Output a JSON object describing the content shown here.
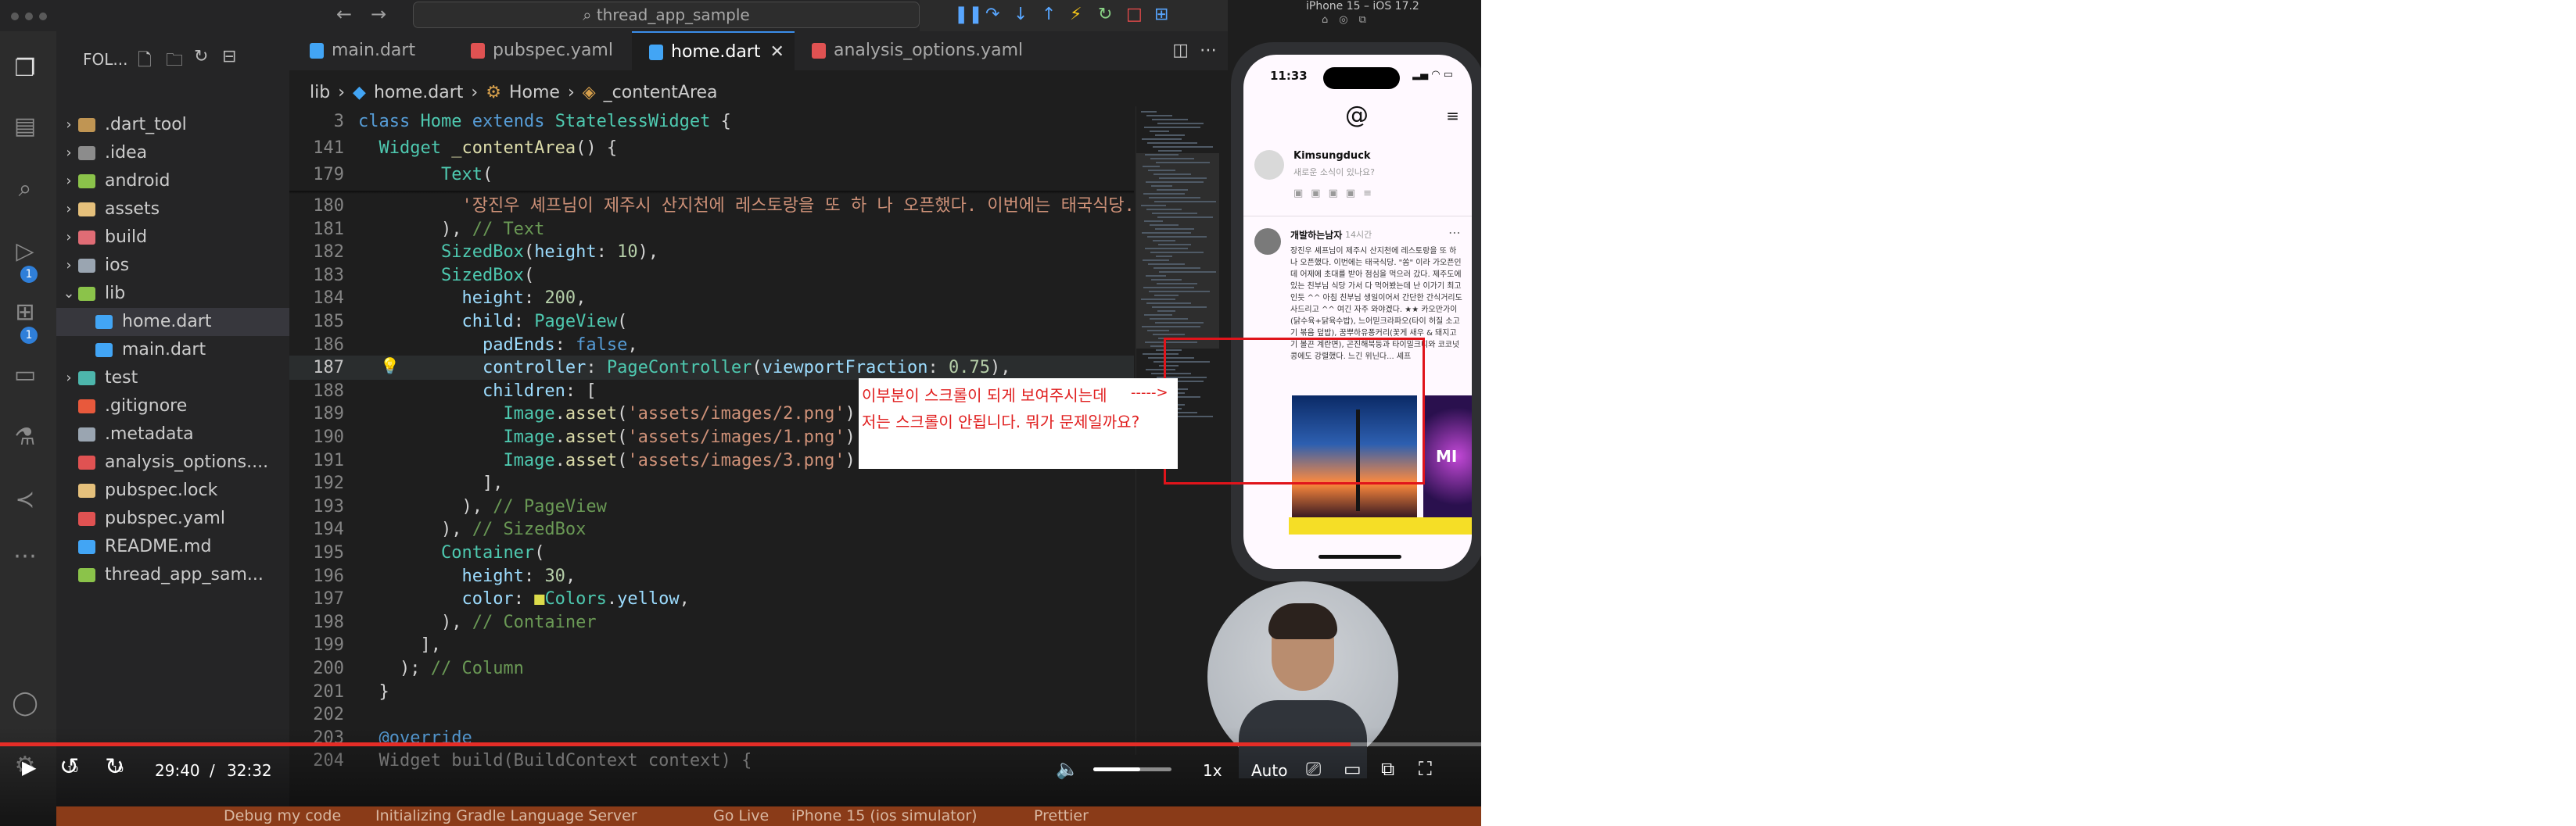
{
  "titlebar": {
    "search": "thread_app_sample",
    "nav_back_icon": "arrow-left-icon",
    "nav_forward_icon": "arrow-right-icon"
  },
  "sidebar": {
    "title": "FOL...",
    "tree": [
      {
        "label": ".dart_tool",
        "type": "folder",
        "expanded": false,
        "icon_color": "#c09553"
      },
      {
        "label": ".idea",
        "type": "folder",
        "expanded": false,
        "icon_color": "#8c8c8c"
      },
      {
        "label": "android",
        "type": "folder",
        "expanded": false,
        "icon_color": "#8bc34a"
      },
      {
        "label": "assets",
        "type": "folder",
        "expanded": false,
        "icon_color": "#e5c07b"
      },
      {
        "label": "build",
        "type": "folder",
        "expanded": false,
        "icon_color": "#e06c75"
      },
      {
        "label": "ios",
        "type": "folder",
        "expanded": false,
        "icon_color": "#9aa5b1"
      },
      {
        "label": "lib",
        "type": "folder",
        "expanded": true,
        "icon_color": "#8bc34a"
      },
      {
        "label": "home.dart",
        "type": "file",
        "indent": 1,
        "selected": true,
        "icon_color": "#42a5f5"
      },
      {
        "label": "main.dart",
        "type": "file",
        "indent": 1,
        "icon_color": "#42a5f5"
      },
      {
        "label": "test",
        "type": "folder",
        "expanded": false,
        "icon_color": "#4db6ac"
      },
      {
        "label": ".gitignore",
        "type": "file",
        "icon_color": "#e8593c"
      },
      {
        "label": ".metadata",
        "type": "file",
        "icon_color": "#9aa5b1"
      },
      {
        "label": "analysis_options....",
        "type": "file",
        "icon_color": "#e05252"
      },
      {
        "label": "pubspec.lock",
        "type": "file",
        "icon_color": "#e5c07b"
      },
      {
        "label": "pubspec.yaml",
        "type": "file",
        "icon_color": "#e05252"
      },
      {
        "label": "README.md",
        "type": "file",
        "icon_color": "#42a5f5"
      },
      {
        "label": "thread_app_sam...",
        "type": "file",
        "icon_color": "#8bc34a"
      }
    ]
  },
  "tabs": [
    {
      "label": "main.dart",
      "icon_color": "#42a5f5"
    },
    {
      "label": "pubspec.yaml",
      "icon_color": "#e05252"
    },
    {
      "label": "home.dart",
      "icon_color": "#42a5f5",
      "active": true
    },
    {
      "label": "analysis_options.yaml",
      "icon_color": "#e05252"
    }
  ],
  "breadcrumb": [
    "lib",
    "home.dart",
    "Home",
    "_contentArea"
  ],
  "sticky_lines": [
    {
      "num": "3",
      "tokens": [
        [
          "k",
          "class "
        ],
        [
          "t",
          "Home "
        ],
        [
          "k",
          "extends "
        ],
        [
          "t",
          "StatelessWidget "
        ],
        [
          "d",
          "{"
        ]
      ]
    },
    {
      "num": "141",
      "tokens": [
        [
          "d",
          "  "
        ],
        [
          "t",
          "Widget "
        ],
        [
          "f",
          "_contentArea"
        ],
        [
          "d",
          "() {"
        ]
      ]
    },
    {
      "num": "179",
      "tokens": [
        [
          "d",
          "        "
        ],
        [
          "t",
          "Text"
        ],
        [
          "d",
          "("
        ]
      ]
    }
  ],
  "code_lines": [
    {
      "num": "180",
      "tokens": [
        [
          "d",
          "          "
        ],
        [
          "s",
          "'장진우 셰프님이 제주시 산지천에 레스토랑을 또 하 나 오픈했다. 이번에는 태국식당. \"쏨\" 이"
        ]
      ]
    },
    {
      "num": "181",
      "tokens": [
        [
          "d",
          "        ), "
        ],
        [
          "c",
          "// Text"
        ]
      ]
    },
    {
      "num": "182",
      "tokens": [
        [
          "d",
          "        "
        ],
        [
          "t",
          "SizedBox"
        ],
        [
          "d",
          "("
        ],
        [
          "p",
          "height"
        ],
        [
          "d",
          ": "
        ],
        [
          "n",
          "10"
        ],
        [
          "d",
          "),"
        ]
      ]
    },
    {
      "num": "183",
      "tokens": [
        [
          "d",
          "        "
        ],
        [
          "t",
          "SizedBox"
        ],
        [
          "d",
          "("
        ]
      ]
    },
    {
      "num": "184",
      "tokens": [
        [
          "d",
          "          "
        ],
        [
          "p",
          "height"
        ],
        [
          "d",
          ": "
        ],
        [
          "n",
          "200"
        ],
        [
          "d",
          ","
        ]
      ]
    },
    {
      "num": "185",
      "tokens": [
        [
          "d",
          "          "
        ],
        [
          "p",
          "child"
        ],
        [
          "d",
          ": "
        ],
        [
          "t",
          "PageView"
        ],
        [
          "d",
          "("
        ]
      ]
    },
    {
      "num": "186",
      "tokens": [
        [
          "d",
          "            "
        ],
        [
          "p",
          "padEnds"
        ],
        [
          "d",
          ": "
        ],
        [
          "k",
          "false"
        ],
        [
          "d",
          ","
        ]
      ]
    },
    {
      "num": "187",
      "current": true,
      "tokens": [
        [
          "d",
          "            "
        ],
        [
          "p",
          "controller"
        ],
        [
          "d",
          ": "
        ],
        [
          "t",
          "PageController"
        ],
        [
          "d",
          "("
        ],
        [
          "p",
          "viewportFraction"
        ],
        [
          "d",
          ": "
        ],
        [
          "n",
          "0.75"
        ],
        [
          "d",
          "),"
        ]
      ]
    },
    {
      "num": "188",
      "tokens": [
        [
          "d",
          "            "
        ],
        [
          "p",
          "children"
        ],
        [
          "d",
          ": ["
        ]
      ]
    },
    {
      "num": "189",
      "tokens": [
        [
          "d",
          "              "
        ],
        [
          "t",
          "Image"
        ],
        [
          "d",
          "."
        ],
        [
          "f",
          "asset"
        ],
        [
          "d",
          "("
        ],
        [
          "s",
          "'assets/images/2.png'"
        ],
        [
          "d",
          "),"
        ]
      ]
    },
    {
      "num": "190",
      "tokens": [
        [
          "d",
          "              "
        ],
        [
          "t",
          "Image"
        ],
        [
          "d",
          "."
        ],
        [
          "f",
          "asset"
        ],
        [
          "d",
          "("
        ],
        [
          "s",
          "'assets/images/1.png'"
        ],
        [
          "d",
          "),"
        ]
      ]
    },
    {
      "num": "191",
      "tokens": [
        [
          "d",
          "              "
        ],
        [
          "t",
          "Image"
        ],
        [
          "d",
          "."
        ],
        [
          "f",
          "asset"
        ],
        [
          "d",
          "("
        ],
        [
          "s",
          "'assets/images/3.png'"
        ],
        [
          "d",
          "),"
        ]
      ]
    },
    {
      "num": "192",
      "tokens": [
        [
          "d",
          "            ],"
        ]
      ]
    },
    {
      "num": "193",
      "tokens": [
        [
          "d",
          "          ), "
        ],
        [
          "c",
          "// PageView"
        ]
      ]
    },
    {
      "num": "194",
      "tokens": [
        [
          "d",
          "        ), "
        ],
        [
          "c",
          "// SizedBox"
        ]
      ]
    },
    {
      "num": "195",
      "tokens": [
        [
          "d",
          "        "
        ],
        [
          "t",
          "Container"
        ],
        [
          "d",
          "("
        ]
      ]
    },
    {
      "num": "196",
      "tokens": [
        [
          "d",
          "          "
        ],
        [
          "p",
          "height"
        ],
        [
          "d",
          ": "
        ],
        [
          "n",
          "30"
        ],
        [
          "d",
          ","
        ]
      ]
    },
    {
      "num": "197",
      "tokens": [
        [
          "d",
          "          "
        ],
        [
          "p",
          "color"
        ],
        [
          "d",
          ": "
        ],
        [
          "y",
          "■"
        ],
        [
          "t",
          "Colors"
        ],
        [
          "d",
          "."
        ],
        [
          "p",
          "yellow"
        ],
        [
          "d",
          ","
        ]
      ]
    },
    {
      "num": "198",
      "tokens": [
        [
          "d",
          "        ), "
        ],
        [
          "c",
          "// Container"
        ]
      ]
    },
    {
      "num": "199",
      "tokens": [
        [
          "d",
          "      ],"
        ]
      ]
    },
    {
      "num": "200",
      "tokens": [
        [
          "d",
          "    ); "
        ],
        [
          "c",
          "// Column"
        ]
      ]
    },
    {
      "num": "201",
      "tokens": [
        [
          "d",
          "  }"
        ]
      ]
    },
    {
      "num": "202",
      "tokens": [
        [
          "d",
          ""
        ]
      ]
    },
    {
      "num": "203",
      "tokens": [
        [
          "d",
          "  "
        ],
        [
          "k",
          "@override"
        ]
      ]
    },
    {
      "num": "204",
      "tokens": [
        [
          "d",
          "  "
        ],
        [
          "gy",
          "Widget build(BuildContext context) {"
        ]
      ]
    }
  ],
  "simulator": {
    "title": "iPhone 15 – iOS 17.2",
    "clock": "11:33",
    "compose_user": "Kimsungduck",
    "compose_hint": "새로운 소식이 있나요?",
    "post_user": "개발하는남자",
    "post_time": "14시간",
    "post_body": "장진우 셰프님이 제주시 산지천에 레스토랑을 또 하나 오픈했다. 이번에는 태국식당. \"쏨\" 이라 가오픈인데 어제에 초대를 받아 점심을 먹으러 갔다. 제주도에 있는 친부님 식당 가서 다 먹어봤는데 난 이가기 최고인듯 ^^ 아침 친부님 생일이어서 간단한 간식거리도 사드리고 ^^ 여긴 자주 와야겠다. ★★ 카오만가이(닭수육+닭육수밥), 느어믿크라파오(타이 허질 소고기 볶음 덮밥), 꿈뿌하유퐁커리(꽃게 새우 & 돼지고기 볼끈 계란면), 곤진해북둥과 타이밀크티와 코코넛콩에도 강렬했다. 느긴 위닌다... 셰프",
    "pageview_partial_text": "MI"
  },
  "annotation": {
    "line1": "이부분이 스크롤이 되게 보여주시는데",
    "line2": "저는 스크롤이 안됩니다. 뭐가 문제일까요?",
    "arrow": "----->",
    "color": "#e01e1e"
  },
  "statusbar": {
    "items": [
      "Debug my code",
      "Initializing Gradle Language Server",
      "Go Live",
      "iPhone 15 (ios simulator)",
      "Prettier"
    ]
  },
  "player": {
    "current_time": "29:40",
    "separator": "/",
    "duration": "32:32",
    "progress": 0.912,
    "volume": 0.6,
    "skip_back_label": "10",
    "skip_forward_label": "10",
    "speed": "1x",
    "quality": "Auto"
  }
}
